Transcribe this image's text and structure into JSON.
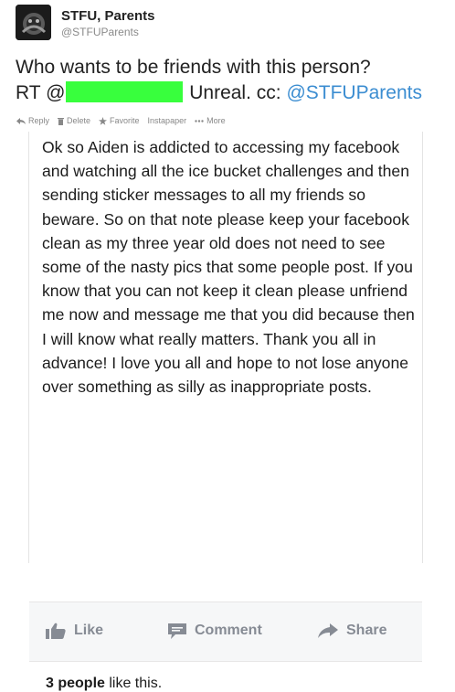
{
  "account": {
    "name": "STFU, Parents",
    "handle": "@STFUParents"
  },
  "tweet": {
    "line1": "Who wants to be friends with this person?",
    "rt_prefix": "RT @",
    "after_redaction": "Unreal. cc: ",
    "mention": "@STFUParents"
  },
  "actions": {
    "reply": "Reply",
    "delete": "Delete",
    "favorite": "Favorite",
    "instapaper": "Instapaper",
    "more": "More"
  },
  "fb_post": {
    "text": "Ok so Aiden is addicted to accessing my facebook and watching all the ice bucket challenges and then sending sticker messages to all my friends so beware. So on that note please keep your facebook clean as my three year old does not need to see some of the nasty pics that some people post. If you know that you can not keep it clean please unfriend me now and message me that you did because then I will know what really matters. Thank you all in advance! I love you all and hope to not lose anyone over something as silly as inappropriate posts.",
    "like_label": "Like",
    "comment_label": "Comment",
    "share_label": "Share",
    "likes_count": "3 people",
    "likes_suffix": " like this."
  },
  "colors": {
    "mention": "#3b8dd1",
    "redaction": "#38ff3d",
    "fb_action_text": "#868b94"
  },
  "icons": {
    "reply": "reply-arrow-icon",
    "delete": "trash-icon",
    "favorite": "star-icon",
    "more": "ellipsis-icon",
    "like": "thumbs-up-icon",
    "comment": "speech-bubble-icon",
    "share": "share-arrow-icon"
  }
}
